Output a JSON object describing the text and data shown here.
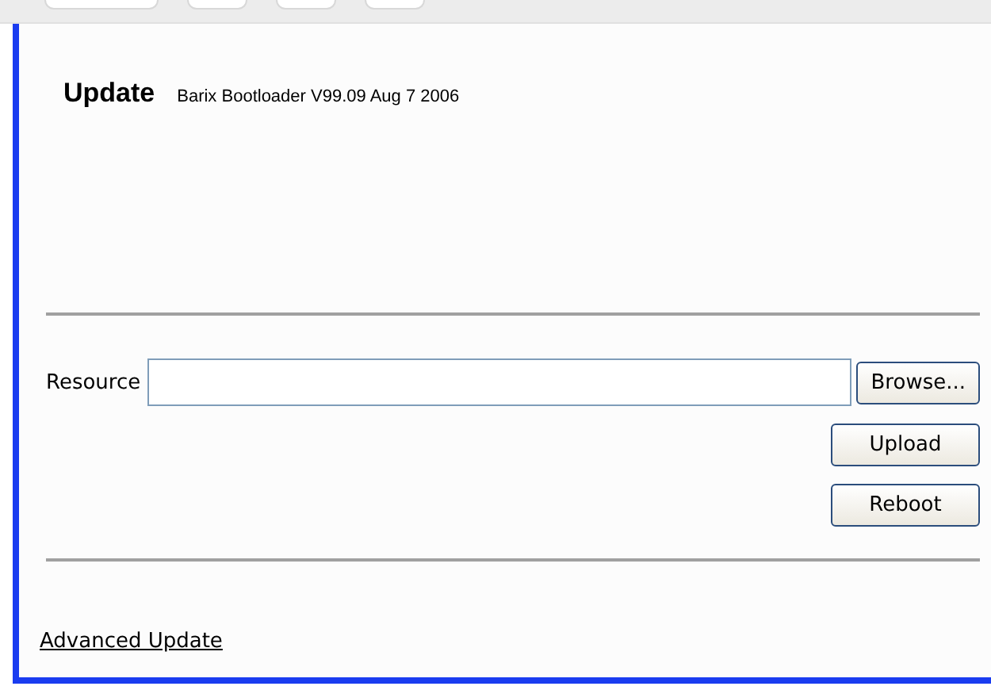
{
  "header": {
    "title": "Update",
    "version": "Barix Bootloader V99.09 Aug 7 2006"
  },
  "resource": {
    "label": "Resource",
    "button": "Browse..."
  },
  "buttons": [
    "Upload",
    "Reboot"
  ],
  "link": "Advanced Update"
}
